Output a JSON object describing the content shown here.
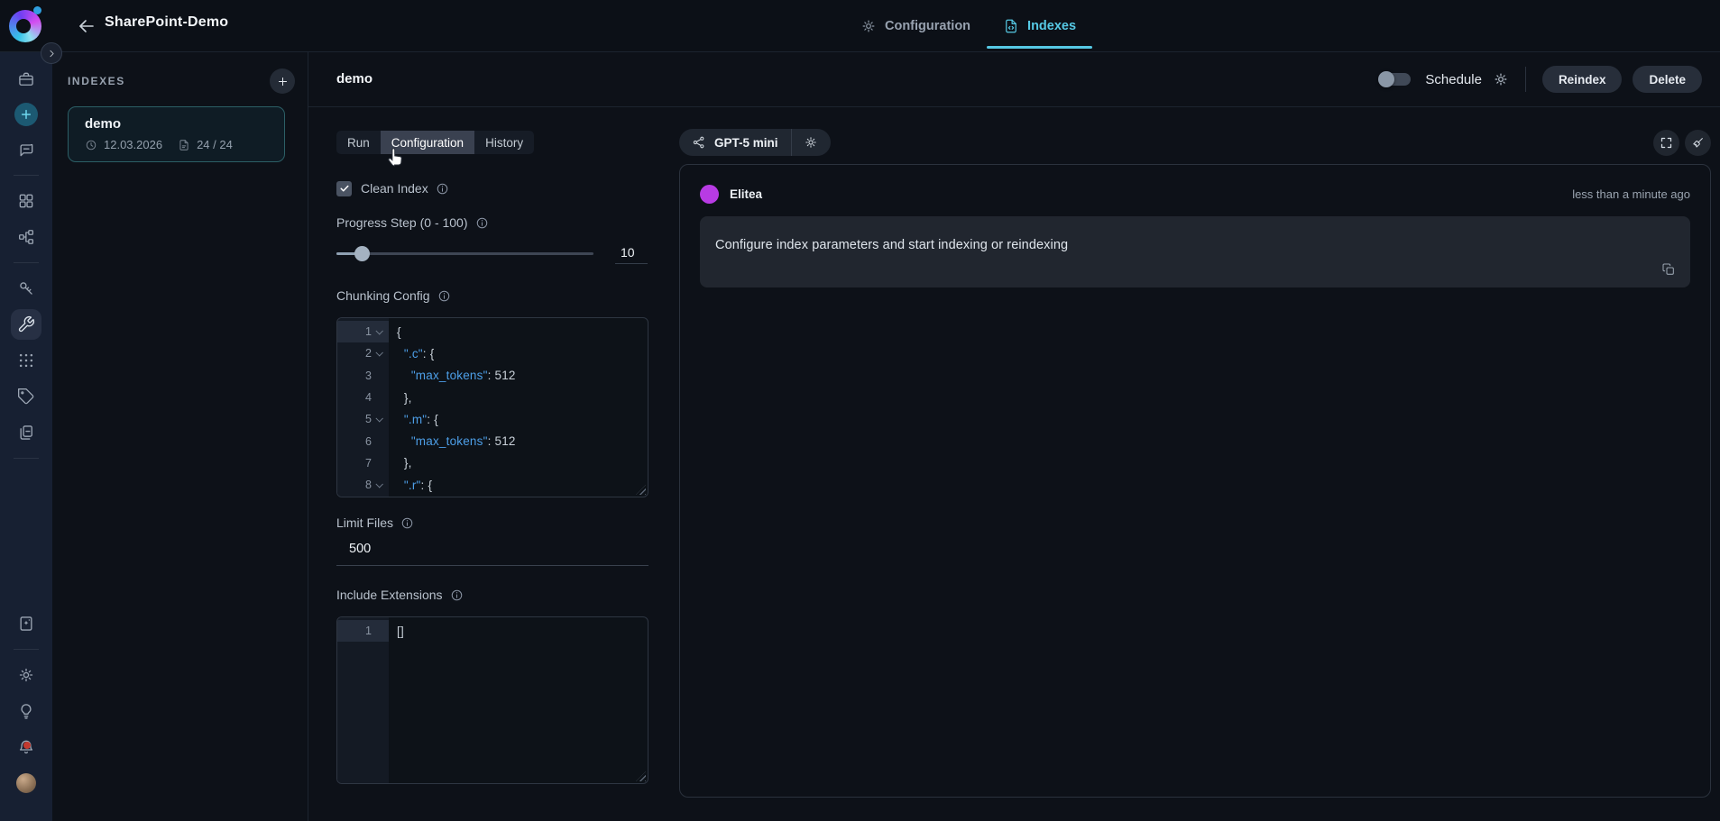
{
  "header": {
    "title": "SharePoint-Demo",
    "nav": [
      {
        "label": "Configuration",
        "icon": "gear",
        "active": false
      },
      {
        "label": "Indexes",
        "icon": "file-code",
        "active": true
      }
    ]
  },
  "sidebar": {
    "top": [
      "briefcase",
      "plus-circle",
      "chat",
      "divider",
      "grid",
      "flow",
      "divider",
      "key",
      "wrench",
      "dots-grid",
      "tag",
      "documents",
      "divider"
    ],
    "bottom": [
      "book-sparkle",
      "divider",
      "gear",
      "bulb",
      "bell",
      "avatar"
    ],
    "active_icon": "wrench",
    "notification_icon": "bell"
  },
  "indexes_panel": {
    "heading": "INDEXES",
    "items": [
      {
        "name": "demo",
        "date": "12.03.2026",
        "progress": "24 / 24"
      }
    ]
  },
  "page": {
    "title": "demo",
    "schedule_label": "Schedule",
    "schedule_on": false,
    "reindex_label": "Reindex",
    "delete_label": "Delete"
  },
  "tabs": {
    "run": "Run",
    "configuration": "Configuration",
    "history": "History",
    "active": "configuration"
  },
  "form": {
    "clean_index": {
      "label": "Clean Index",
      "checked": true
    },
    "progress_step": {
      "label": "Progress Step (0 - 100)",
      "value": "10",
      "min": 0,
      "max": 100
    },
    "chunking_config": {
      "label": "Chunking Config",
      "lines": [
        {
          "n": "1",
          "fold": true,
          "tokens": [
            [
              "p",
              "{"
            ]
          ]
        },
        {
          "n": "2",
          "fold": true,
          "tokens": [
            [
              "p",
              "  "
            ],
            [
              "k",
              "\".c\""
            ],
            [
              "p",
              ": {"
            ]
          ]
        },
        {
          "n": "3",
          "fold": false,
          "tokens": [
            [
              "p",
              "    "
            ],
            [
              "k",
              "\"max_tokens\""
            ],
            [
              "p",
              ": "
            ],
            [
              "num",
              "512"
            ]
          ]
        },
        {
          "n": "4",
          "fold": false,
          "tokens": [
            [
              "p",
              "  },"
            ]
          ]
        },
        {
          "n": "5",
          "fold": true,
          "tokens": [
            [
              "p",
              "  "
            ],
            [
              "k",
              "\".m\""
            ],
            [
              "p",
              ": {"
            ]
          ]
        },
        {
          "n": "6",
          "fold": false,
          "tokens": [
            [
              "p",
              "    "
            ],
            [
              "k",
              "\"max_tokens\""
            ],
            [
              "p",
              ": "
            ],
            [
              "num",
              "512"
            ]
          ]
        },
        {
          "n": "7",
          "fold": false,
          "tokens": [
            [
              "p",
              "  },"
            ]
          ]
        },
        {
          "n": "8",
          "fold": true,
          "tokens": [
            [
              "p",
              "  "
            ],
            [
              "k",
              "\".r\""
            ],
            [
              "p",
              ": {"
            ]
          ]
        }
      ]
    },
    "limit_files": {
      "label": "Limit Files",
      "value": "500"
    },
    "include_extensions": {
      "label": "Include Extensions",
      "lines": [
        {
          "n": "1",
          "fold": false,
          "tokens": [
            [
              "p",
              "[]"
            ]
          ]
        }
      ]
    }
  },
  "chat": {
    "model": "GPT-5 mini",
    "message": {
      "author": "Elitea",
      "time": "less than a minute ago",
      "text": "Configure index parameters and start indexing or reindexing"
    }
  },
  "colors": {
    "accent_cyan": "#56c9e5",
    "card_border": "#2c5f66",
    "code_key": "#4d9fe8",
    "notification_red": "#c3392f"
  }
}
